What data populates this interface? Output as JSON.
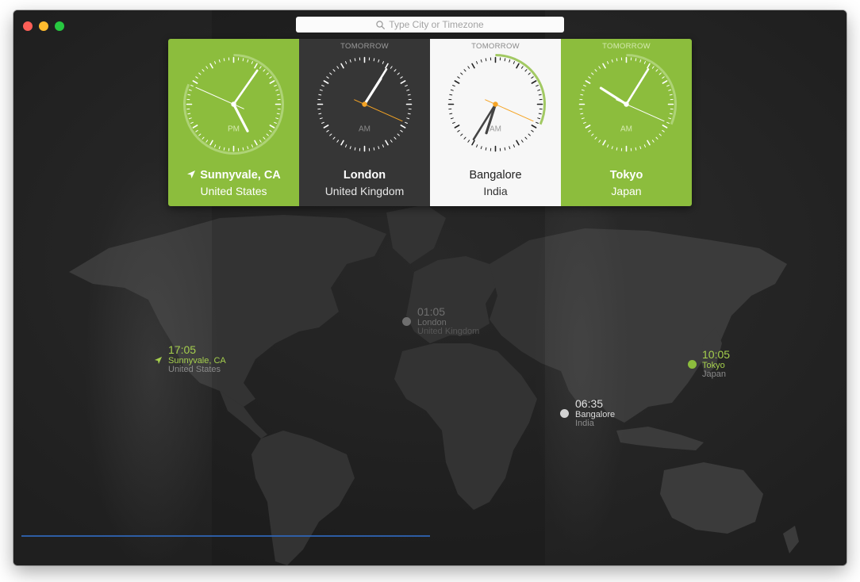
{
  "search": {
    "placeholder": "Type City or Timezone"
  },
  "colors": {
    "green": "#8cbd3d",
    "dark_card": "#363636",
    "light_card": "#f7f7f7",
    "window_bg": "#252525",
    "land": "#3a3a3a",
    "second_hand": "#f5a425",
    "accent_text": "#a5cf4d"
  },
  "cards": [
    {
      "tomorrow": "",
      "city": "Sunnyvale, CA",
      "country": "United States",
      "ampm": "PM",
      "theme": "green",
      "current_location": true,
      "time": "17:05"
    },
    {
      "tomorrow": "TOMORROW",
      "city": "London",
      "country": "United Kingdom",
      "ampm": "AM",
      "theme": "dark",
      "current_location": false,
      "time": "01:05"
    },
    {
      "tomorrow": "TOMORROW",
      "city": "Bangalore",
      "country": "India",
      "ampm": "AM",
      "theme": "light",
      "current_location": false,
      "time": "06:35"
    },
    {
      "tomorrow": "TOMORROW",
      "city": "Tokyo",
      "country": "Japan",
      "ampm": "AM",
      "theme": "green",
      "current_location": false,
      "time": "10:05"
    }
  ],
  "pins": [
    {
      "time": "17:05",
      "city": "Sunnyvale, CA",
      "country": "United States"
    },
    {
      "time": "01:05",
      "city": "London",
      "country": "United Kingdom"
    },
    {
      "time": "06:35",
      "city": "Bangalore",
      "country": "India"
    },
    {
      "time": "10:05",
      "city": "Tokyo",
      "country": "Japan"
    }
  ]
}
